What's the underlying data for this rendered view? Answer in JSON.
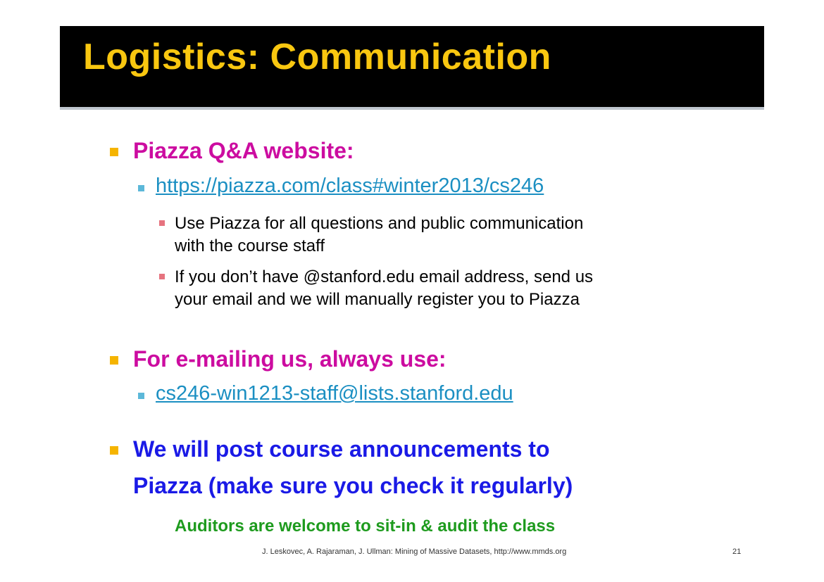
{
  "slide": {
    "title": "Logistics: Communication",
    "items": [
      {
        "heading": "Piazza Q&A website:",
        "link": "https://piazza.com/class#winter2013/cs246",
        "notes": [
          [
            "Use Piazza for all questions and public communication",
            "with the course staff"
          ],
          [
            "If you don’t have @stanford.edu email address, send us",
            "your email and we will manually register you to Piazza"
          ]
        ]
      },
      {
        "heading": "For e-mailing us, always use:",
        "link": "cs246-win1213-staff@lists.stanford.edu"
      },
      {
        "heading_lines": [
          "We will post course announcements to",
          "Piazza (make sure you check it regularly)"
        ]
      }
    ],
    "auditors_note": "Auditors are welcome to sit-in & audit the class",
    "footer": "J. Leskovec, A. Rajaraman, J. Ullman: Mining of Massive Datasets, http://www.mmds.org",
    "page_number": "21"
  },
  "colors": {
    "title": "#f9c710",
    "title_bg": "#000000",
    "heading_magenta": "#cc0ca0",
    "heading_blue": "#1a1ae6",
    "link": "#1b8fc2",
    "auditors": "#1e9b1e",
    "bullet_level1": "#f5b400",
    "bullet_level2": "#5cb8d9",
    "bullet_level3": "#e6737f"
  }
}
